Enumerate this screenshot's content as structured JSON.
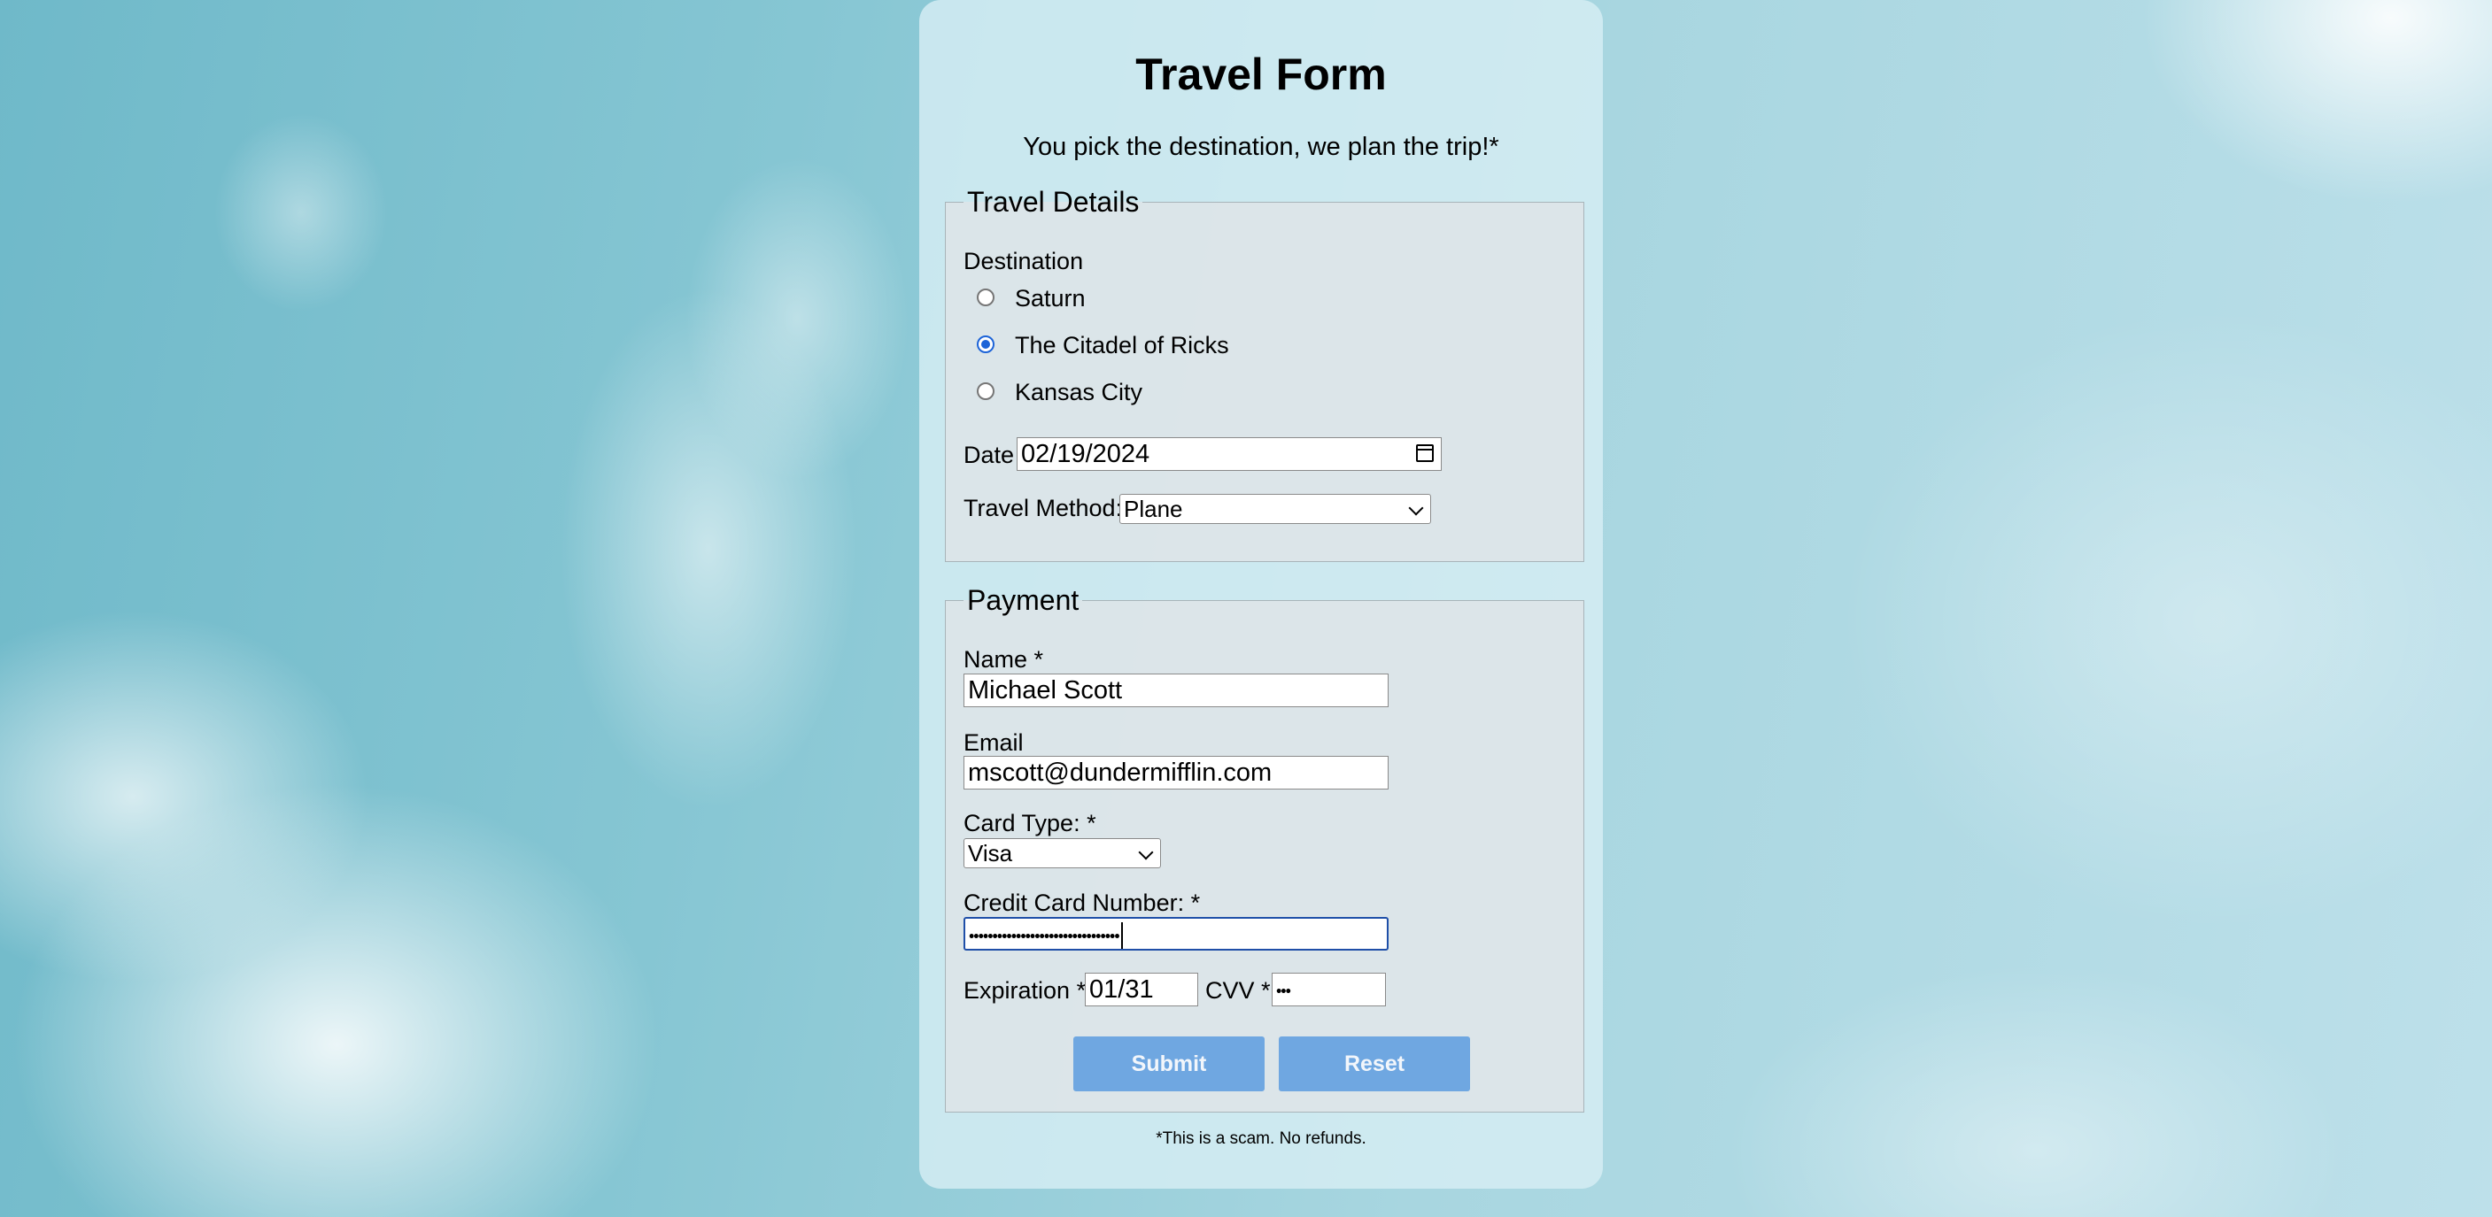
{
  "form": {
    "title": "Travel Form",
    "subtitle": "You pick the destination, we plan the trip!*",
    "footnote": "*This is a scam. No refunds."
  },
  "travel": {
    "legend": "Travel Details",
    "destination_label": "Destination",
    "destinations": [
      {
        "label": "Saturn",
        "checked": false
      },
      {
        "label": "The Citadel of Ricks",
        "checked": true
      },
      {
        "label": "Kansas City",
        "checked": false
      }
    ],
    "date_label": "Date",
    "date_value": "02/19/2024",
    "method_label": "Travel Method:",
    "method_value": "Plane"
  },
  "payment": {
    "legend": "Payment",
    "name_label": "Name *",
    "name_value": "Michael Scott",
    "email_label": "Email",
    "email_value": "mscott@dundermifflin.com",
    "card_type_label": "Card Type: *",
    "card_type_value": "Visa",
    "card_number_label": "Credit Card Number: *",
    "card_number_masked": "••••••••••••••••••••••••••••••••",
    "expiration_label": "Expiration *",
    "expiration_value": "01/31",
    "cvv_label": "CVV *",
    "cvv_masked": "•••"
  },
  "buttons": {
    "submit": "Submit",
    "reset": "Reset"
  },
  "colors": {
    "button_bg": "#6fa7e1",
    "radio_checked": "#1d64d8",
    "focus_border": "#1f4fa8"
  }
}
